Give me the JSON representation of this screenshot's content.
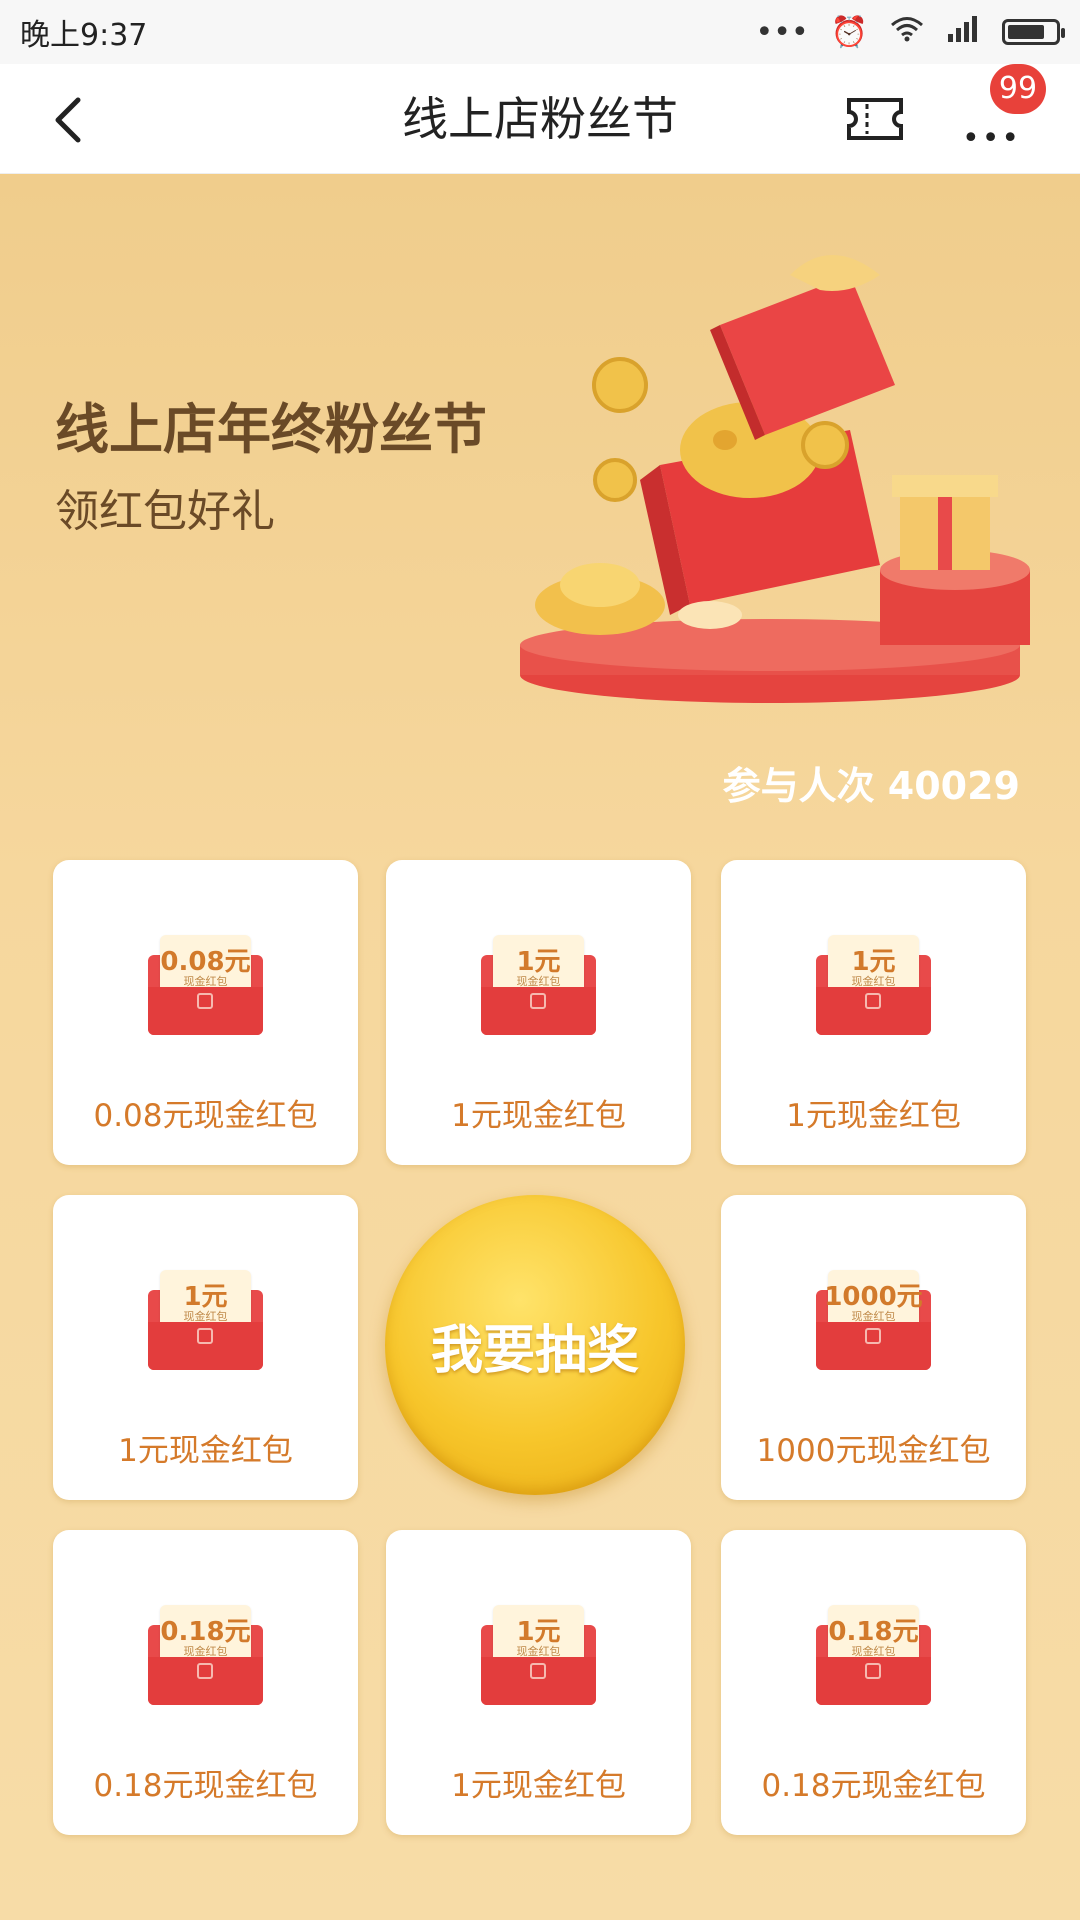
{
  "status_bar": {
    "time": "晚上9:37",
    "battery_level_pct": 70
  },
  "nav": {
    "title": "线上店粉丝节",
    "badge": "99"
  },
  "hero": {
    "title": "线上店年终粉丝节",
    "subtitle": "领红包好礼"
  },
  "participants": "参与人次 40029",
  "lottery_button": "我要抽奖",
  "prizes": [
    {
      "amount": "0.08元",
      "label": "0.08元现金红包"
    },
    {
      "amount": "1元",
      "label": "1元现金红包"
    },
    {
      "amount": "1元",
      "label": "1元现金红包"
    },
    {
      "amount": "1元",
      "label": "1元现金红包"
    },
    {
      "amount": "1000元",
      "label": "1000元现金红包"
    },
    {
      "amount": "0.18元",
      "label": "0.18元现金红包"
    },
    {
      "amount": "1元",
      "label": "1元现金红包"
    },
    {
      "amount": "0.18元",
      "label": "0.18元现金红包"
    }
  ],
  "envelope_caption": "现金红包",
  "colors": {
    "accent_red": "#e33d3d",
    "gold": "#f7c62b",
    "label_orange": "#d57a2a",
    "badge_red": "#e8413a"
  }
}
